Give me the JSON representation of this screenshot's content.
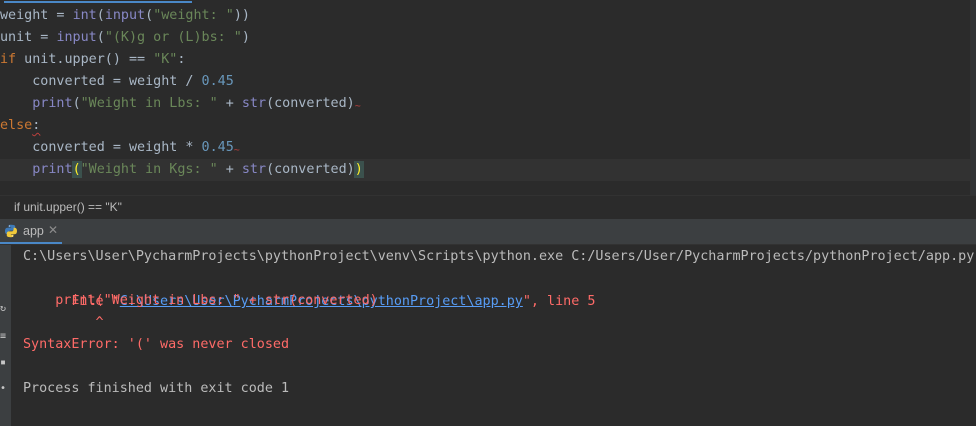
{
  "editor": {
    "lines": [
      {
        "id": "1",
        "parts": [
          {
            "t": "weight = ",
            "c": "pl"
          },
          {
            "t": "int",
            "c": "bi"
          },
          {
            "t": "(",
            "c": "pl"
          },
          {
            "t": "input",
            "c": "bi"
          },
          {
            "t": "(",
            "c": "pl"
          },
          {
            "t": "\"weight: \"",
            "c": "str"
          },
          {
            "t": "))",
            "c": "pl"
          }
        ]
      },
      {
        "id": "2",
        "parts": [
          {
            "t": "unit = ",
            "c": "pl"
          },
          {
            "t": "input",
            "c": "bi"
          },
          {
            "t": "(",
            "c": "pl"
          },
          {
            "t": "\"(K)g or (L)bs: \"",
            "c": "str"
          },
          {
            "t": ")",
            "c": "pl"
          }
        ]
      },
      {
        "id": "3",
        "parts": [
          {
            "t": "if",
            "c": "kw"
          },
          {
            "t": " unit.upper() == ",
            "c": "pl"
          },
          {
            "t": "\"K\"",
            "c": "str"
          },
          {
            "t": ":",
            "c": "pl"
          }
        ]
      },
      {
        "id": "4",
        "parts": [
          {
            "t": "    converted = weight / ",
            "c": "pl"
          },
          {
            "t": "0.45",
            "c": "num"
          }
        ]
      },
      {
        "id": "5",
        "parts": [
          {
            "t": "    ",
            "c": "pl"
          },
          {
            "t": "print",
            "c": "bi"
          },
          {
            "t": "(",
            "c": "pl"
          },
          {
            "t": "\"Weight in Lbs: \"",
            "c": "str"
          },
          {
            "t": " + ",
            "c": "pl"
          },
          {
            "t": "str",
            "c": "bi"
          },
          {
            "t": "(converted)",
            "c": "pl"
          }
        ]
      },
      {
        "id": "6",
        "parts": [
          {
            "t": "else",
            "c": "kw"
          },
          {
            "t": ":",
            "c": "pl"
          }
        ]
      },
      {
        "id": "7",
        "parts": [
          {
            "t": "    converted = weight * ",
            "c": "pl"
          },
          {
            "t": "0.45",
            "c": "num"
          }
        ]
      },
      {
        "id": "8",
        "parts": [
          {
            "t": "    ",
            "c": "pl"
          },
          {
            "t": "print",
            "c": "bi"
          },
          {
            "t": "(",
            "c": "pl"
          },
          {
            "t": "\"Weight in Kgs: \"",
            "c": "str"
          },
          {
            "t": " + ",
            "c": "pl"
          },
          {
            "t": "str",
            "c": "bi"
          },
          {
            "t": "(converted)",
            "c": "pl"
          },
          {
            "t": ")",
            "c": "pl"
          }
        ]
      }
    ]
  },
  "breadcrumb": {
    "text": "if unit.upper() == \"K\""
  },
  "run": {
    "tab_label": "app",
    "console": {
      "command": "C:\\Users\\User\\PycharmProjects\\pythonProject\\venv\\Scripts\\python.exe C:/Users/User/PycharmProjects/pythonProject/app.py",
      "file_prefix": "  File \"",
      "file_link": "C:\\Users\\User\\PycharmProjects\\pythonProject\\app.py",
      "file_suffix": "\", line 5",
      "code_line": "    print(\"Weight in Lbs: \" + str(converted)",
      "caret_line": "         ^",
      "error": "SyntaxError: '(' was never closed",
      "exit": "Process finished with exit code 1"
    }
  },
  "colors": {
    "keyword": "#cc7832",
    "builtin": "#8888c6",
    "string": "#6a8759",
    "number": "#6897bb",
    "plain": "#a9b7c6",
    "error": "#ff6b68",
    "link": "#589df6"
  }
}
